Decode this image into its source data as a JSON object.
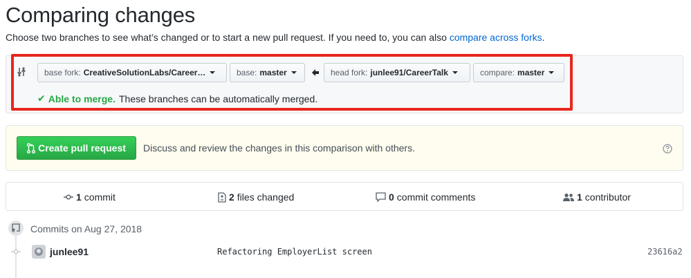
{
  "header": {
    "title": "Comparing changes",
    "description": "Choose two branches to see what’s changed or to start a new pull request. If you need to, you can also ",
    "link": "compare across forks",
    "link_suffix": "."
  },
  "range": {
    "base_fork_label": "base fork:",
    "base_fork_value": "CreativeSolutionLabs/Career…",
    "base_label": "base:",
    "base_value": "master",
    "head_fork_label": "head fork:",
    "head_fork_value": "junlee91/CareerTalk",
    "compare_label": "compare:",
    "compare_value": "master",
    "merge_ok": "Able to merge.",
    "merge_text": "These branches can be automatically merged."
  },
  "pull_request": {
    "button_label": "Create pull request",
    "description": "Discuss and review the changes in this comparison with others."
  },
  "stats": {
    "commits_count": "1",
    "commits_label": "commit",
    "files_count": "2",
    "files_label": "files changed",
    "comments_count": "0",
    "comments_label": "commit comments",
    "contributors_count": "1",
    "contributors_label": "contributor"
  },
  "commits": {
    "date_heading": "Commits on Aug 27, 2018",
    "items": [
      {
        "author": "junlee91",
        "message": "Refactoring EmployerList screen",
        "sha": "23616a2"
      }
    ]
  },
  "colors": {
    "accent_link": "#0366d6",
    "success": "#28a745",
    "highlight": "#e8261c",
    "pr_banner": "#fffdef"
  }
}
